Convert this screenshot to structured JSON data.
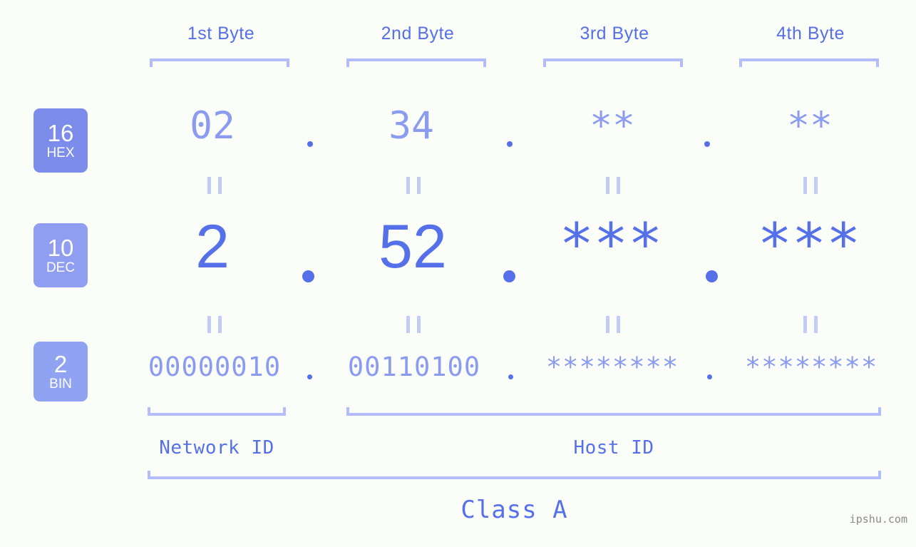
{
  "page": {
    "background_color": "#fbfdf8",
    "accent_color": "#5570e8",
    "light_accent_color": "#8b9bf0",
    "bracket_color": "#b3bdfa",
    "watermark": "ipshu.com"
  },
  "byte_headers": [
    {
      "label": "1st Byte"
    },
    {
      "label": "2nd Byte"
    },
    {
      "label": "3rd Byte"
    },
    {
      "label": "4th Byte"
    }
  ],
  "bases": [
    {
      "number": "16",
      "name": "HEX",
      "color": "#7b8ceb"
    },
    {
      "number": "10",
      "name": "DEC",
      "color": "#8f9ef1"
    },
    {
      "number": "2",
      "name": "BIN",
      "color": "#8fa3f2"
    }
  ],
  "rows": {
    "hex": {
      "base_number": "16",
      "base_name": "HEX",
      "values": [
        "02",
        "34",
        "**",
        "**"
      ],
      "separator": "."
    },
    "dec": {
      "base_number": "10",
      "base_name": "DEC",
      "values": [
        "2",
        "52",
        "***",
        "***"
      ],
      "separator": "."
    },
    "bin": {
      "base_number": "2",
      "base_name": "BIN",
      "values": [
        "00000010",
        "00110100",
        "********",
        "********"
      ],
      "separator": "."
    }
  },
  "equals_symbol": "=",
  "sections": {
    "network_id": "Network ID",
    "host_id": "Host ID",
    "class": "Class A"
  }
}
